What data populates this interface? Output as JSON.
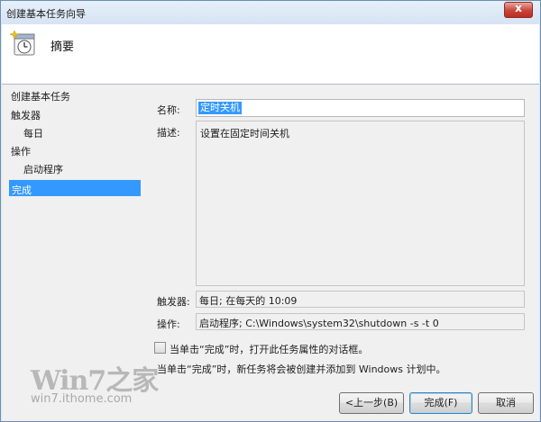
{
  "window": {
    "title": "创建基本任务向导",
    "close_label": "x"
  },
  "header": {
    "title": "摘要",
    "icon": "scheduled-task-clock-icon"
  },
  "sidebar": {
    "items": [
      {
        "label": "创建基本任务",
        "level": 0,
        "selected": false
      },
      {
        "label": "触发器",
        "level": 0,
        "selected": false
      },
      {
        "label": "每日",
        "level": 1,
        "selected": false
      },
      {
        "label": "操作",
        "level": 0,
        "selected": false
      },
      {
        "label": "启动程序",
        "level": 1,
        "selected": false
      },
      {
        "label": "完成",
        "level": 0,
        "selected": true
      }
    ]
  },
  "form": {
    "name_label": "名称:",
    "name_value": "定时关机",
    "desc_label": "描述:",
    "desc_value": "设置在固定时间关机",
    "trigger_label": "触发器:",
    "trigger_value": "每日; 在每天的 10:09",
    "action_label": "操作:",
    "action_value": "启动程序; C:\\Windows\\system32\\shutdown -s -t 0"
  },
  "options": {
    "checkbox_label": "当单击“完成”时，打开此任务属性的对话框。",
    "checkbox_checked": false,
    "info_text": "当单击“完成”时，新任务将会被创建并添加到 Windows 计划中。"
  },
  "buttons": {
    "back": "<上一步(B)",
    "finish": "完成(F)",
    "cancel": "取消"
  },
  "watermark": {
    "logo": "Win7之家",
    "url": "win7.ithome.com"
  },
  "colors": {
    "selection": "#3399ff",
    "window_frame": "#dbe6f4"
  }
}
